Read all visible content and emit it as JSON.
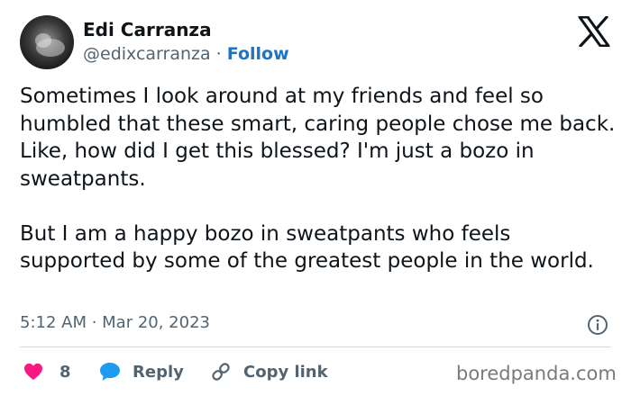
{
  "author": {
    "name": "Edi Carranza",
    "handle": "@edixcarranza",
    "separator": "·",
    "follow_label": "Follow"
  },
  "tweet": {
    "text": "Sometimes I look around at my friends and feel so humbled that these smart, caring people chose me back. Like, how did I get this blessed? I'm just a bozo in sweatpants.\n\nBut I am a happy bozo in sweatpants who feels supported by some of the greatest people in the world.",
    "timestamp": "5:12 AM · Mar 20, 2023"
  },
  "actions": {
    "like_count": "8",
    "reply_label": "Reply",
    "copy_label": "Copy link"
  },
  "watermark": "boredpanda.com",
  "icons": {
    "logo": "x-logo-icon",
    "info": "info-icon",
    "like": "heart-icon",
    "reply": "speech-bubble-icon",
    "copy": "link-icon"
  },
  "colors": {
    "heart": "#f91880",
    "reply": "#1d9bf0",
    "follow": "#1d74c7",
    "secondary_text": "#536471"
  }
}
